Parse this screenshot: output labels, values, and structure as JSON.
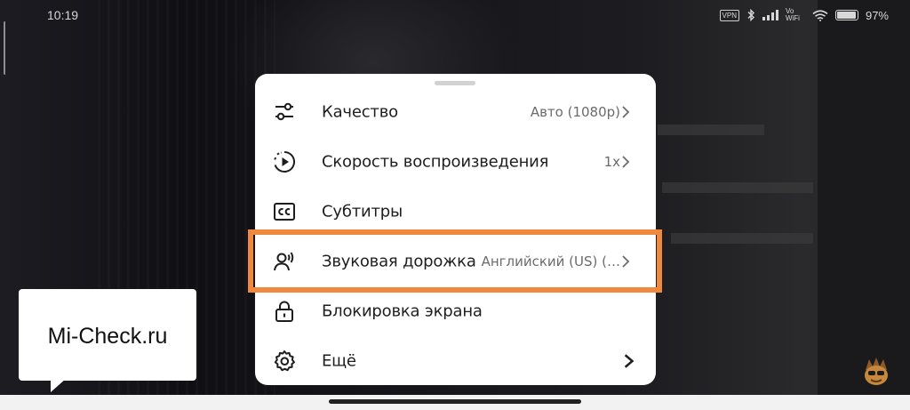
{
  "status_bar": {
    "time": "10:19",
    "vpn": "VPN",
    "wifi_label": "Vo WiFi",
    "battery": "97%"
  },
  "menu": {
    "items": [
      {
        "icon": "sliders-icon",
        "label": "Качество",
        "value": "Авто (1080p)",
        "has_chevron": true
      },
      {
        "icon": "playback-speed-icon",
        "label": "Скорость воспроизведения",
        "value": "1x",
        "has_chevron": true
      },
      {
        "icon": "closed-captions-icon",
        "label": "Субтитры",
        "value": "",
        "has_chevron": false
      },
      {
        "icon": "audio-track-icon",
        "label": "Звуковая дорожка",
        "value": "Английский (US) (…",
        "has_chevron": true,
        "highlighted": true
      },
      {
        "icon": "lock-icon",
        "label": "Блокировка экрана",
        "value": "",
        "has_chevron": false
      },
      {
        "icon": "gear-icon",
        "label": "Ещё",
        "value": "",
        "has_chevron": true
      }
    ]
  },
  "watermark": {
    "text": "Mi-Check.ru"
  },
  "colors": {
    "highlight": "#f0883e",
    "sheet": "#ffffff",
    "text": "#1e1e1e",
    "secondary_text": "#6b6b6b"
  }
}
